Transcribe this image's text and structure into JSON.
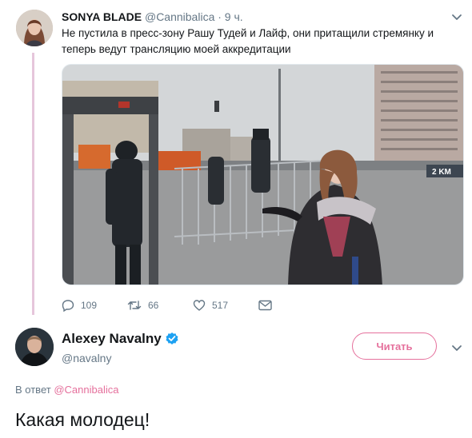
{
  "tweet1": {
    "display_name": "SONYA BLADE",
    "handle": "@Cannibalica",
    "time": "· 9 ч.",
    "text": "Не пустила в пресс-зону Рашу Тудей и Лайф, они притащили стремянку и теперь ведут трансляцию моей аккредитации",
    "media_sign_text": "2 KM",
    "reply_count": "109",
    "retweet_count": "66",
    "like_count": "517",
    "icons": {
      "menu": "chevron-down-icon",
      "reply": "reply-icon",
      "retweet": "retweet-icon",
      "like": "heart-icon",
      "dm": "mail-icon"
    }
  },
  "tweet2": {
    "display_name": "Alexey Navalny",
    "handle": "@navalny",
    "follow_label": "Читать",
    "reply_prefix": "В ответ",
    "reply_to_handle": "@Cannibalica",
    "text": "Какая молодец!",
    "icons": {
      "verified": "verified-badge-icon",
      "menu": "chevron-down-icon"
    }
  },
  "colors": {
    "accent": "#e5709c",
    "thread_line": "#e6c6db",
    "secondary_text": "#657786",
    "verified": "#1da1f2"
  }
}
